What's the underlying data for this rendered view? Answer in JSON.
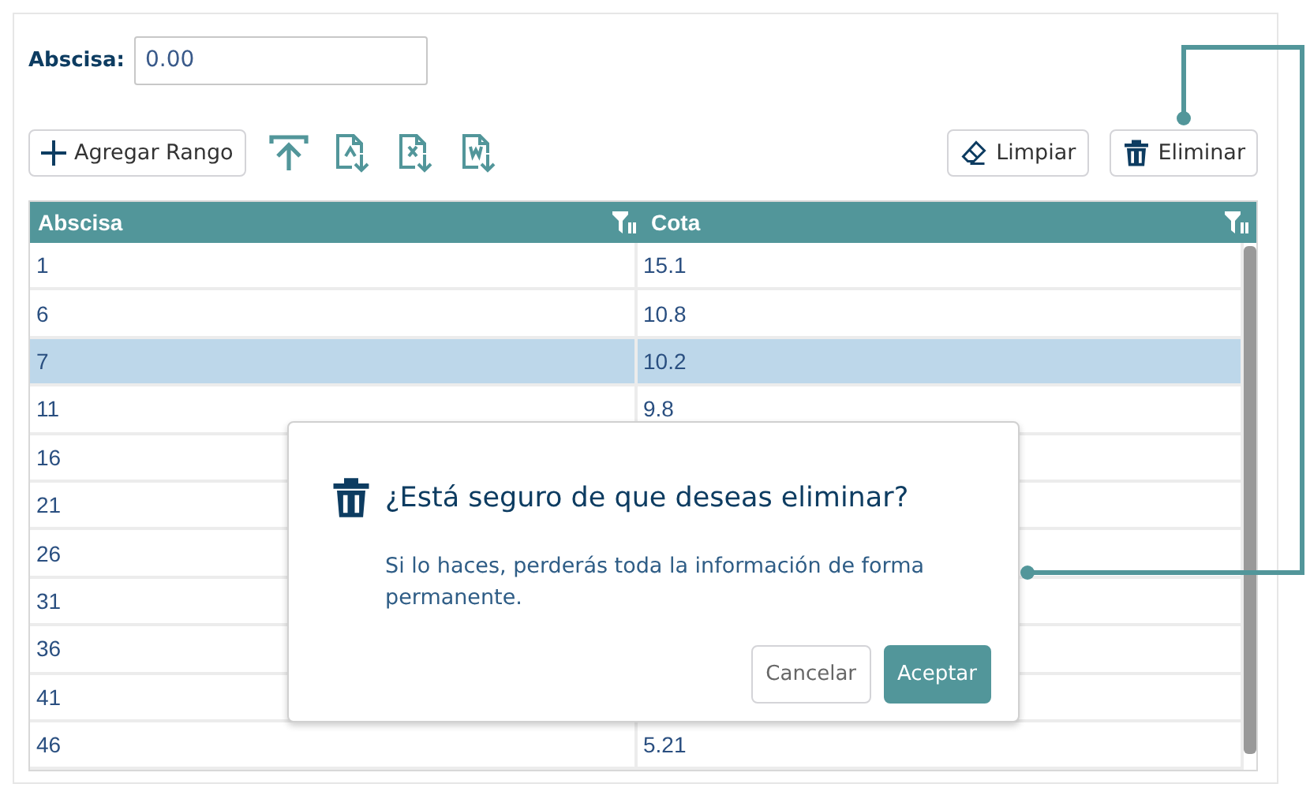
{
  "form": {
    "label": "Abscisa:",
    "value": "0.00"
  },
  "add_button": {
    "label": "Agregar Rango"
  },
  "icon_buttons": [
    {
      "kind": "upload"
    },
    {
      "kind": "pdf"
    },
    {
      "kind": "excel"
    },
    {
      "kind": "word"
    }
  ],
  "actions": [
    {
      "kind": "eraser",
      "label": "Limpiar"
    },
    {
      "kind": "trash",
      "label": "Eliminar"
    }
  ],
  "table": {
    "columns": [
      "Abscisa",
      "Cota"
    ],
    "rows": [
      {
        "abscisa": "1",
        "cota": "15.1",
        "selected": false
      },
      {
        "abscisa": "6",
        "cota": "10.8",
        "selected": false
      },
      {
        "abscisa": "7",
        "cota": "10.2",
        "selected": true
      },
      {
        "abscisa": "11",
        "cota": "9.8",
        "selected": false
      },
      {
        "abscisa": "16",
        "selected": false
      },
      {
        "abscisa": "21",
        "selected": false
      },
      {
        "abscisa": "26",
        "selected": false
      },
      {
        "abscisa": "31",
        "selected": false
      },
      {
        "abscisa": "36",
        "selected": false
      },
      {
        "abscisa": "41",
        "selected": false
      },
      {
        "abscisa": "46",
        "cota": "5.21",
        "selected": false
      }
    ]
  },
  "dialog": {
    "title": "¿Está seguro de que deseas eliminar?",
    "message": "Si lo haces, perderás toda la información de forma permanente.",
    "buttons": [
      {
        "label": "Cancelar",
        "kind": "secondary"
      },
      {
        "label": "Aceptar",
        "kind": "primary"
      }
    ]
  }
}
